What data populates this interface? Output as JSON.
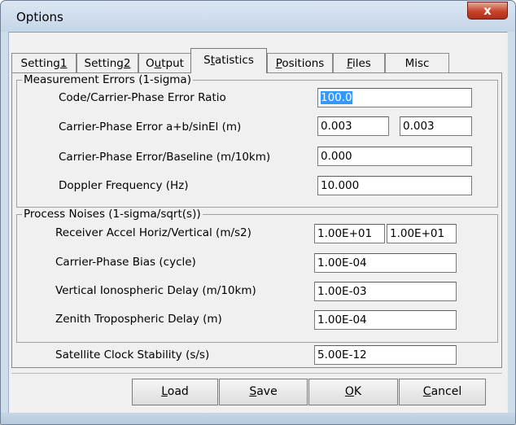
{
  "window": {
    "title": "Options",
    "close_glyph": "x"
  },
  "tabs": [
    {
      "pre": "Setting",
      "key": "1",
      "post": ""
    },
    {
      "pre": "Setting",
      "key": "2",
      "post": ""
    },
    {
      "pre": "O",
      "key": "u",
      "post": "tput"
    },
    {
      "pre": "S",
      "key": "t",
      "post": "atistics"
    },
    {
      "pre": "",
      "key": "P",
      "post": "ositions"
    },
    {
      "pre": "",
      "key": "F",
      "post": "iles"
    },
    {
      "pre": "Misc",
      "key": "",
      "post": ""
    }
  ],
  "active_tab": "Statistics",
  "measurement": {
    "title": "Measurement Errors (1-sigma)",
    "code_carrier_label": "Code/Carrier-Phase Error Ratio",
    "code_carrier_value": "100.0",
    "carrier_err_label": "Carrier-Phase Error a+b/sinEl (m)",
    "carrier_err_a": "0.003",
    "carrier_err_b": "0.003",
    "carrier_baseline_label": "Carrier-Phase Error/Baseline (m/10km)",
    "carrier_baseline_value": "0.000",
    "doppler_label": "Doppler Frequency (Hz)",
    "doppler_value": "10.000"
  },
  "process": {
    "title": "Process Noises (1-sigma/sqrt(s))",
    "accel_label": "Receiver Accel Horiz/Vertical (m/s2)",
    "accel_h": "1.00E+01",
    "accel_v": "1.00E+01",
    "bias_label": "Carrier-Phase Bias (cycle)",
    "bias_value": "1.00E-04",
    "iono_label": "Vertical Ionospheric Delay (m/10km)",
    "iono_value": "1.00E-03",
    "tropo_label": "Zenith Tropospheric Delay (m)",
    "tropo_value": "1.00E-04"
  },
  "clock": {
    "label": "Satellite Clock Stability (s/s)",
    "value": "5.00E-12"
  },
  "buttons": {
    "load": {
      "key": "L",
      "rest": "oad"
    },
    "save": {
      "key": "S",
      "rest": "ave"
    },
    "ok": {
      "key": "O",
      "rest": "K"
    },
    "cancel": {
      "key": "C",
      "rest": "ancel"
    }
  },
  "colors": {
    "selection": "#3399ff",
    "close_button": "#c9432b",
    "frame": "#cfdcea"
  },
  "icons": {
    "close": "close-icon"
  }
}
